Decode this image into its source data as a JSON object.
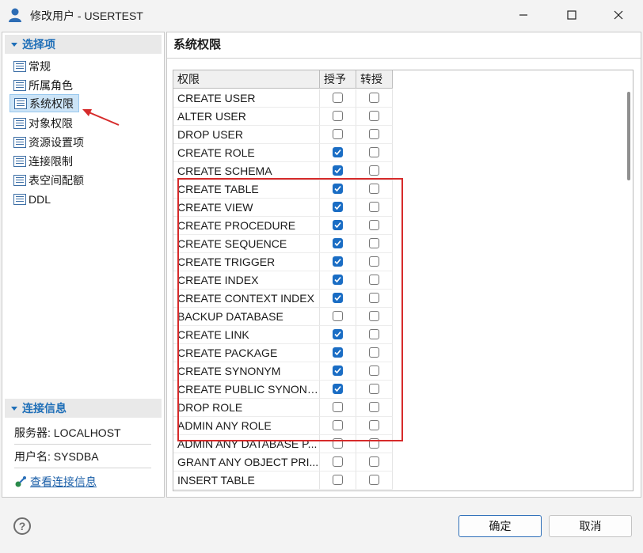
{
  "window": {
    "title": "修改用户 - USERTEST",
    "icons": {
      "app": "user-icon",
      "minimize": "minimize-icon",
      "maximize": "maximize-icon",
      "close": "close-icon"
    }
  },
  "sidebar": {
    "options_header": "选择项",
    "items": [
      {
        "label": "常规"
      },
      {
        "label": "所属角色"
      },
      {
        "label": "系统权限",
        "selected": true
      },
      {
        "label": "对象权限"
      },
      {
        "label": "资源设置项"
      },
      {
        "label": "连接限制"
      },
      {
        "label": "表空间配额"
      },
      {
        "label": "DDL"
      }
    ],
    "connection_header": "连接信息",
    "server": "服务器: LOCALHOST",
    "username": "用户名: SYSDBA",
    "view_link": "查看连接信息"
  },
  "main": {
    "title": "系统权限",
    "columns": {
      "privilege": "权限",
      "grant": "授予",
      "transfer": "转授"
    },
    "rows": [
      {
        "name": "CREATE USER",
        "grant": false,
        "transfer": false
      },
      {
        "name": "ALTER USER",
        "grant": false,
        "transfer": false
      },
      {
        "name": "DROP USER",
        "grant": false,
        "transfer": false
      },
      {
        "name": "CREATE ROLE",
        "grant": true,
        "transfer": false
      },
      {
        "name": "CREATE SCHEMA",
        "grant": true,
        "transfer": false
      },
      {
        "name": "CREATE TABLE",
        "grant": true,
        "transfer": false
      },
      {
        "name": "CREATE VIEW",
        "grant": true,
        "transfer": false
      },
      {
        "name": "CREATE PROCEDURE",
        "grant": true,
        "transfer": false
      },
      {
        "name": "CREATE SEQUENCE",
        "grant": true,
        "transfer": false
      },
      {
        "name": "CREATE TRIGGER",
        "grant": true,
        "transfer": false
      },
      {
        "name": "CREATE INDEX",
        "grant": true,
        "transfer": false
      },
      {
        "name": "CREATE CONTEXT INDEX",
        "grant": true,
        "transfer": false
      },
      {
        "name": "BACKUP DATABASE",
        "grant": false,
        "transfer": false
      },
      {
        "name": "CREATE LINK",
        "grant": true,
        "transfer": false
      },
      {
        "name": "CREATE PACKAGE",
        "grant": true,
        "transfer": false
      },
      {
        "name": "CREATE SYNONYM",
        "grant": true,
        "transfer": false
      },
      {
        "name": "CREATE PUBLIC SYNONY...",
        "grant": true,
        "transfer": false
      },
      {
        "name": "DROP ROLE",
        "grant": false,
        "transfer": false
      },
      {
        "name": "ADMIN ANY ROLE",
        "grant": false,
        "transfer": false
      },
      {
        "name": "ADMIN ANY DATABASE P...",
        "grant": false,
        "transfer": false
      },
      {
        "name": "GRANT ANY OBJECT PRI...",
        "grant": false,
        "transfer": false
      },
      {
        "name": "INSERT TABLE",
        "grant": false,
        "transfer": false
      }
    ]
  },
  "footer": {
    "help_glyph": "?",
    "ok_label": "确定",
    "cancel_label": "取消"
  },
  "colors": {
    "accent": "#1f6fb8",
    "checkbox_checked": "#1a6dc4",
    "annotation_red": "#d62b2b"
  }
}
